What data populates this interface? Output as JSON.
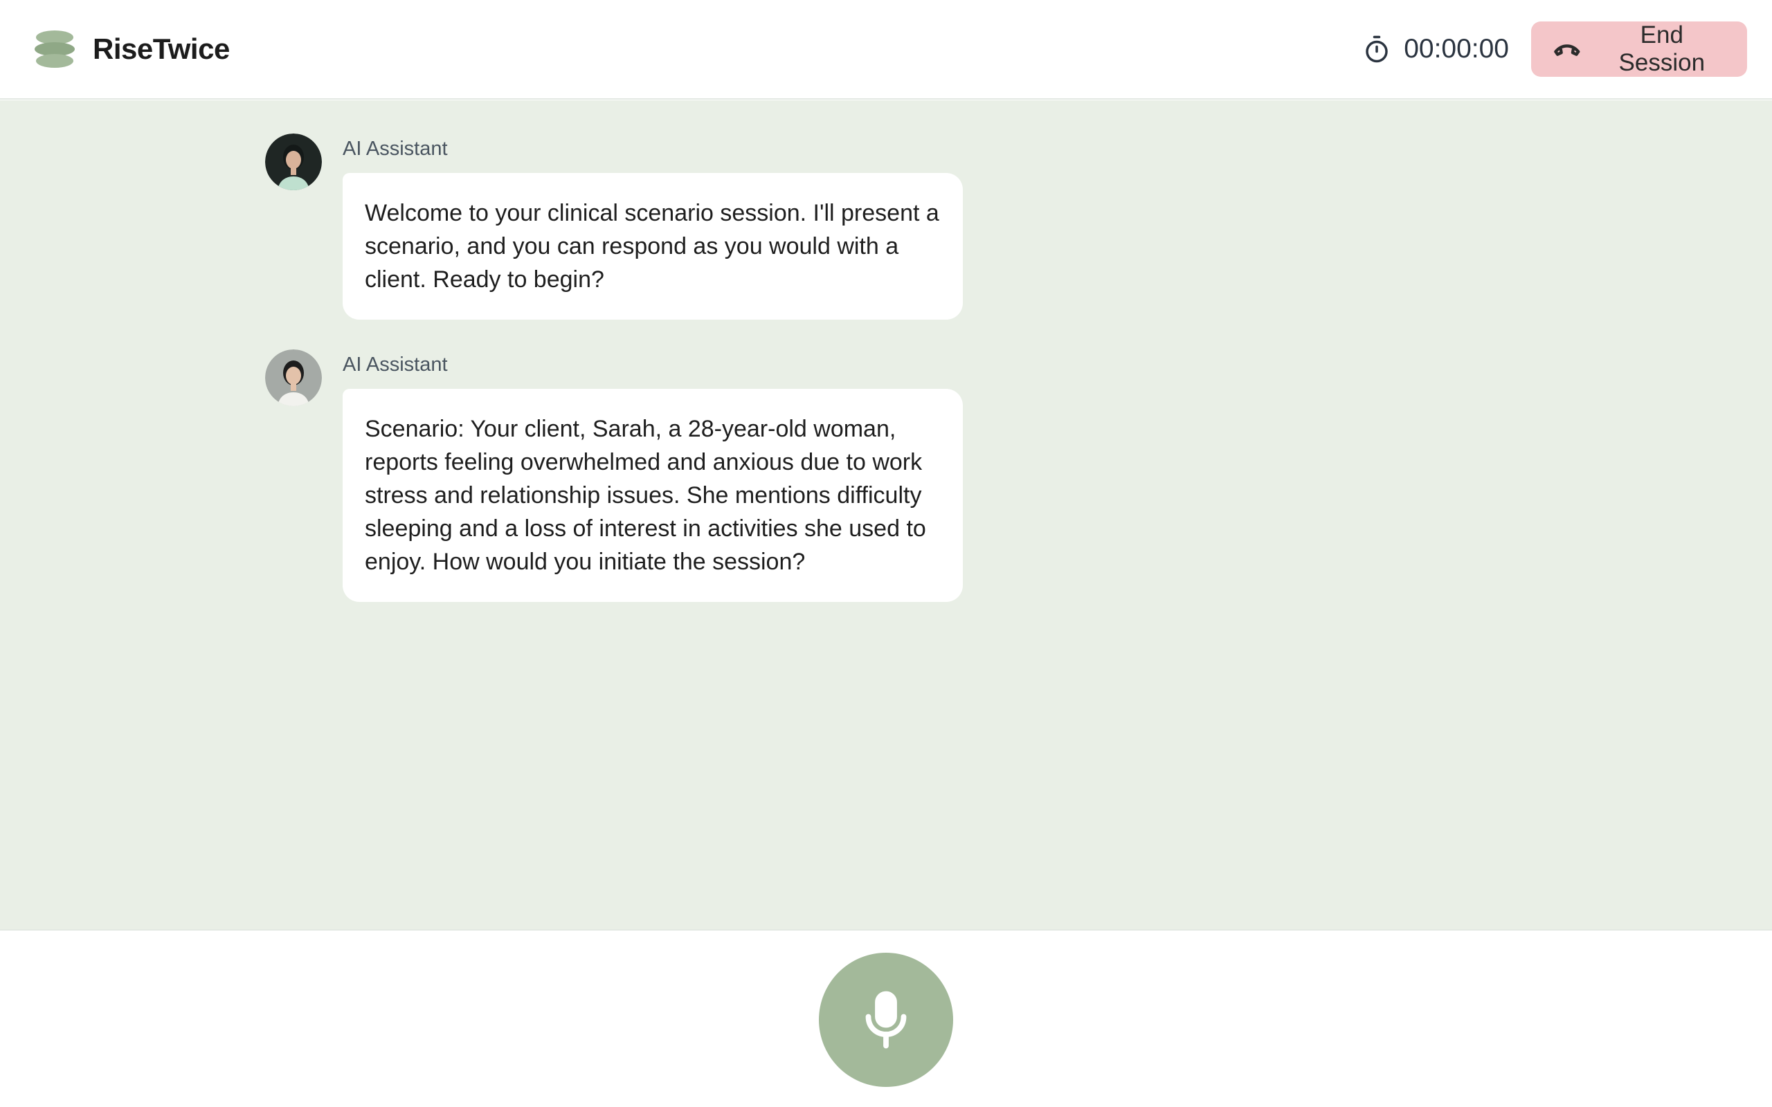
{
  "header": {
    "brand_name": "RiseTwice",
    "timer": "00:00:00",
    "end_session_label": "End Session"
  },
  "messages": [
    {
      "sender": "AI Assistant",
      "text": "Welcome to your clinical scenario session. I'll present a scenario, and you can respond as you would with a client. Ready to begin?"
    },
    {
      "sender": "AI Assistant",
      "text": "Scenario: Your client, Sarah, a 28-year-old woman, reports feeling overwhelmed and anxious due to work stress and relationship issues. She mentions difficulty sleeping and a loss of interest in activities she used to enjoy. How would you initiate the session?"
    }
  ],
  "colors": {
    "brand_green": "#a3b99a",
    "chat_background": "#e9efe6",
    "end_session_bg": "#f4c6c9"
  },
  "icons": {
    "logo": "stacked-discs-logo",
    "timer": "stopwatch-icon",
    "end_session": "phone-hangup-icon",
    "mic": "microphone-icon"
  }
}
